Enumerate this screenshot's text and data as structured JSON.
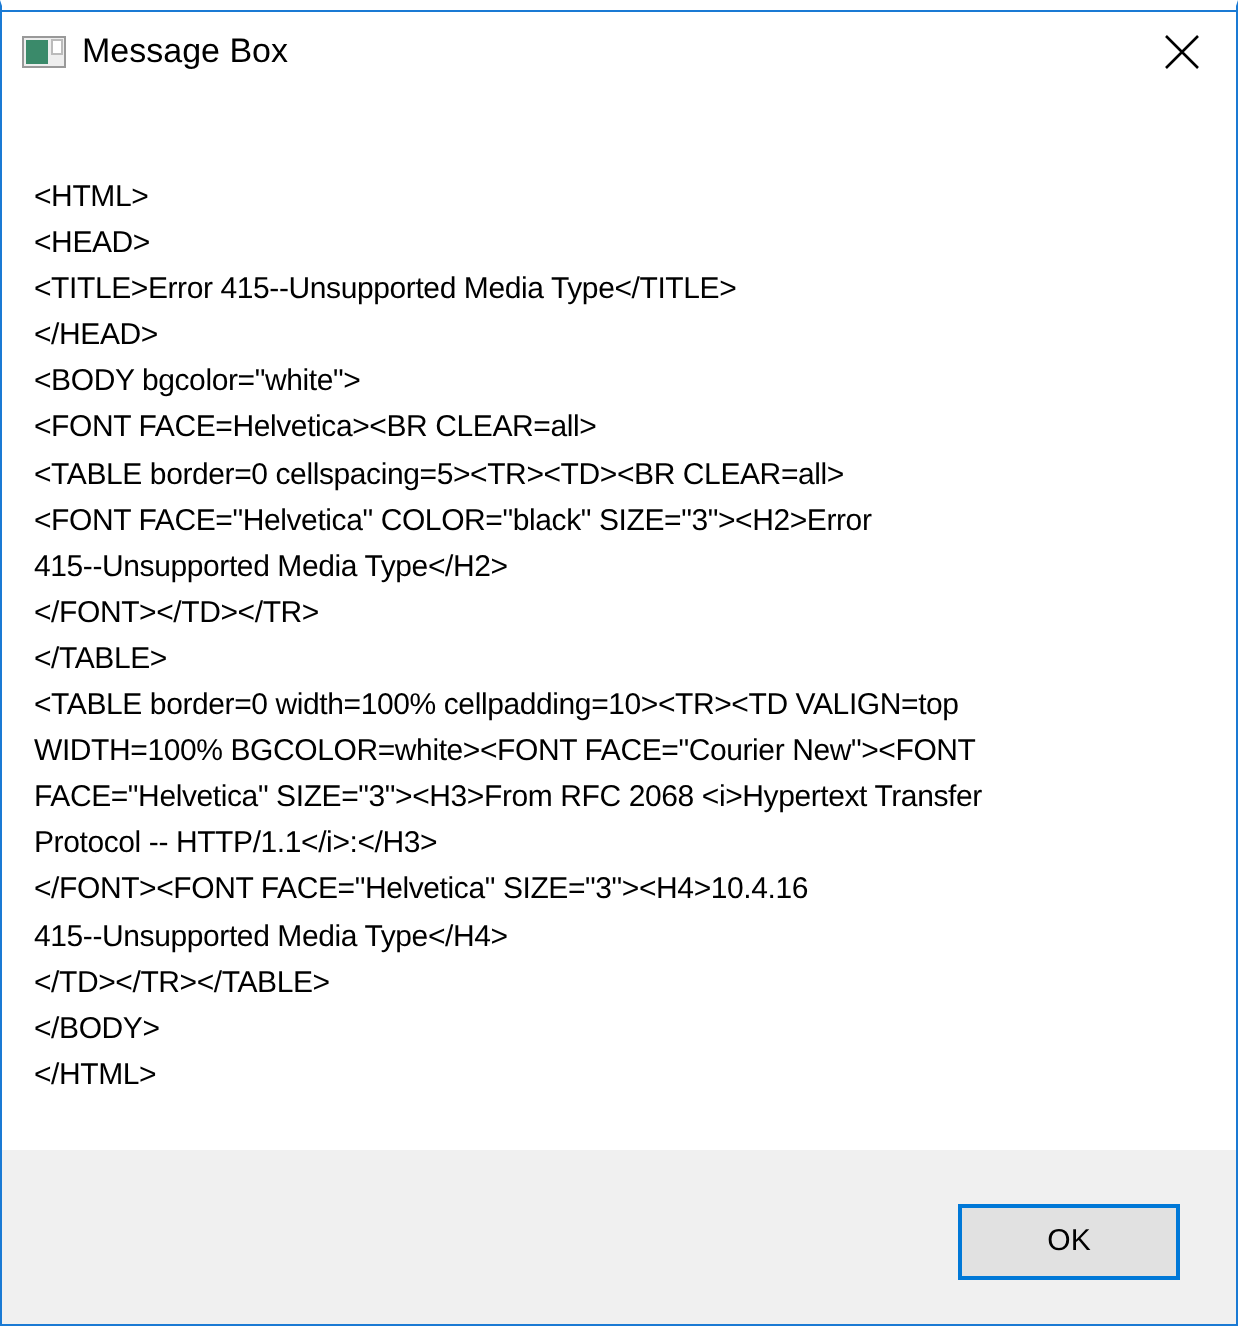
{
  "window": {
    "title": "Message Box"
  },
  "message": {
    "lines": [
      "<HTML>",
      "<HEAD>",
      "<TITLE>Error 415--Unsupported Media Type</TITLE>",
      "</HEAD>",
      "<BODY bgcolor=\"white\">",
      "<FONT FACE=Helvetica><BR CLEAR=all>",
      "<TABLE border=0 cellspacing=5><TR><TD><BR CLEAR=all>",
      "<FONT FACE=\"Helvetica\" COLOR=\"black\" SIZE=\"3\"><H2>Error",
      "415--Unsupported Media Type</H2>",
      "</FONT></TD></TR>",
      "</TABLE>",
      "<TABLE border=0 width=100% cellpadding=10><TR><TD VALIGN=top",
      "WIDTH=100% BGCOLOR=white><FONT FACE=\"Courier New\"><FONT",
      "FACE=\"Helvetica\" SIZE=\"3\"><H3>From RFC 2068 <i>Hypertext Transfer",
      "Protocol -- HTTP/1.1</i>:</H3>",
      "</FONT><FONT FACE=\"Helvetica\" SIZE=\"3\"><H4>10.4.16",
      "415--Unsupported Media Type</H4>",
      "</TD></TR></TABLE>",
      "</BODY>",
      "</HTML>"
    ]
  },
  "buttons": [
    {
      "label": "OK",
      "focused": true
    }
  ]
}
